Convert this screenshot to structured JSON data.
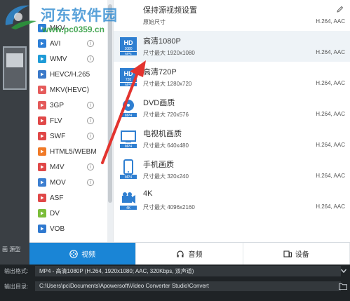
{
  "watermark": {
    "title": "河东软件园",
    "url": "www.pc0359.cn"
  },
  "formats": [
    {
      "label": "MKV",
      "info": false,
      "color": "#2e7fd6"
    },
    {
      "label": "AVI",
      "info": true,
      "color": "#2e7fd6"
    },
    {
      "label": "WMV",
      "info": true,
      "color": "#1f9bd7"
    },
    {
      "label": "HEVC/H.265",
      "info": false,
      "color": "#3a79c9"
    },
    {
      "label": "MKV(HEVC)",
      "info": false,
      "color": "#e55b5b"
    },
    {
      "label": "3GP",
      "info": true,
      "color": "#e45a5a"
    },
    {
      "label": "FLV",
      "info": true,
      "color": "#e04848"
    },
    {
      "label": "SWF",
      "info": true,
      "color": "#e04848"
    },
    {
      "label": "HTML5/WEBM",
      "info": false,
      "color": "#f07a28"
    },
    {
      "label": "M4V",
      "info": true,
      "color": "#e04848"
    },
    {
      "label": "MOV",
      "info": true,
      "color": "#3d7fd0"
    },
    {
      "label": "ASF",
      "info": false,
      "color": "#e04848"
    },
    {
      "label": "DV",
      "info": false,
      "color": "#7bbd3a"
    },
    {
      "label": "VOB",
      "info": false,
      "color": "#2f79cf"
    }
  ],
  "presets": [
    {
      "title": "保持源视频设置",
      "size": "原始尺寸",
      "codec": "H.264, AAC",
      "icon": "source-icon",
      "edit": true
    },
    {
      "title": "高清1080P",
      "size": "尺寸最大  1920x1080",
      "codec": "H.264, AAC",
      "icon": "hd-1080-icon",
      "edit": false
    },
    {
      "title": "高清720P",
      "size": "尺寸最大  1280x720",
      "codec": "H.264, AAC",
      "icon": "hd-720-icon",
      "edit": false
    },
    {
      "title": "DVD画质",
      "size": "尺寸最大  720x576",
      "codec": "H.264, AAC",
      "icon": "dvd-icon",
      "edit": false
    },
    {
      "title": "电视机画质",
      "size": "尺寸最大  640x480",
      "codec": "H.264, AAC",
      "icon": "tv-icon",
      "edit": false
    },
    {
      "title": "手机画质",
      "size": "尺寸最大  320x240",
      "codec": "H.264, AAC",
      "icon": "phone-icon",
      "edit": false
    },
    {
      "title": "4K",
      "size": "尺寸最大  4096x2160",
      "codec": "H.264, AAC",
      "icon": "4k-icon",
      "edit": false
    }
  ],
  "preset_badges": {
    "mp4": "MP4",
    "fourk": "4K",
    "hd": "HD",
    "hd1080": "1080",
    "hd720": "720"
  },
  "tabs": [
    {
      "label": "视频"
    },
    {
      "label": "音频"
    },
    {
      "label": "设备"
    }
  ],
  "left_stub": "画 源型",
  "output": {
    "format_label": "输出格式:",
    "format_value": "MP4 - 高清1080P (H.264, 1920x1080; AAC, 320Kbps, 双声道)",
    "dir_label": "输出目录:",
    "dir_value": "C:\\Users\\pc\\Documents\\Apowersoft\\Video Converter Studio\\Convert"
  },
  "colors": {
    "accent": "#1a85d6",
    "arrow": "#e3342f"
  }
}
